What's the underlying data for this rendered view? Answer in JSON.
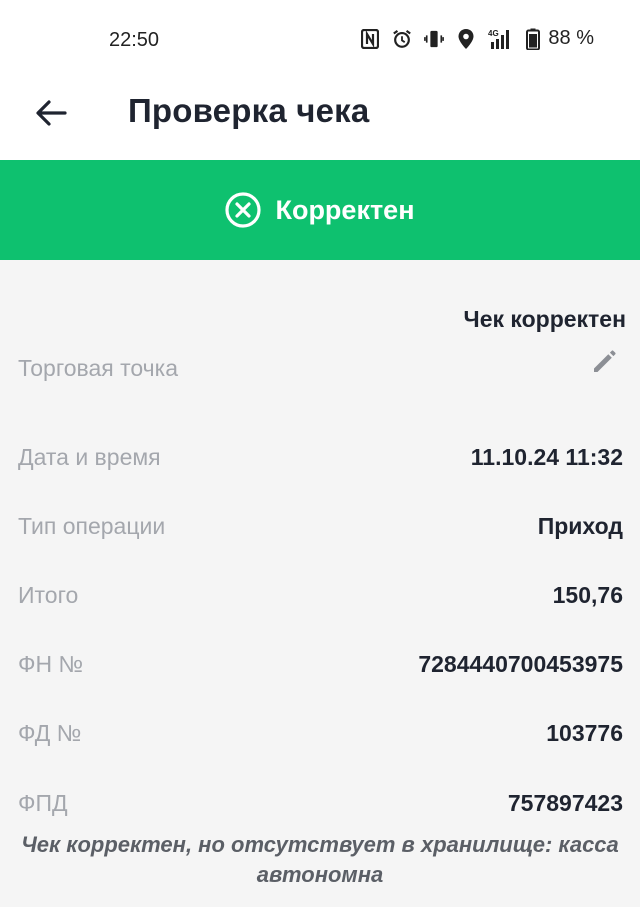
{
  "status_bar": {
    "time": "22:50",
    "battery": "88 %",
    "icons": [
      "nfc-icon",
      "alarm-icon",
      "vibrate-icon",
      "location-icon",
      "signal-4g-icon",
      "battery-icon"
    ]
  },
  "header": {
    "title": "Проверка чека",
    "back_icon": "arrow-left-icon"
  },
  "banner": {
    "text": "Корректен",
    "icon": "circle-x-icon",
    "color": "#0ec16f"
  },
  "shop": {
    "name": "Чек корректен",
    "label": "Торговая точка",
    "edit_icon": "pencil-icon"
  },
  "fields": [
    {
      "label": "Дата и время",
      "value": "11.10.24 11:32"
    },
    {
      "label": "Тип операции",
      "value": "Приход"
    },
    {
      "label": "Итого",
      "value": "150,76"
    },
    {
      "label": "ФН №",
      "value": "7284440700453975"
    },
    {
      "label": "ФД №",
      "value": "103776"
    },
    {
      "label": "ФПД",
      "value": "757897423"
    }
  ],
  "note": "Чек корректен, но отсутствует в хранилище: касса автономна"
}
